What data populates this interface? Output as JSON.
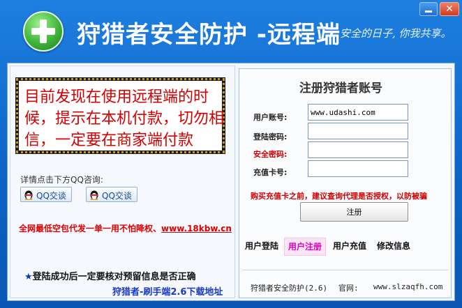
{
  "window": {
    "title": "狩猎者安全防护 -远程端",
    "slogan": "安全的日子, 你我共享。",
    "close_glyph": "✕"
  },
  "left": {
    "warning": "目前发现在使用远程端的时候，提示在本机付款，切勿相信，一定要在商家端付款",
    "detail": "详情点击下方QQ咨询:",
    "qq_buttons": [
      {
        "label": "QQ交谈",
        "icon": "penguin-icon"
      },
      {
        "label": "QQ交谈",
        "icon": "penguin-icon"
      }
    ],
    "promo_text": "全网最低空包代发一单一用不怕降权、",
    "promo_link": "www.18kbw.cn",
    "star": "★",
    "verify_note": "登陆成功后一定要核对预留信息是否正确",
    "download_link": "狩猎者-刷手端2.6下载地址"
  },
  "register": {
    "title": "注册狩猎者账号",
    "fields": [
      {
        "label": "用户账号:",
        "value": "www.udashi.com",
        "color": "#222222"
      },
      {
        "label": "登陆密码:",
        "value": "",
        "color": "#222222"
      },
      {
        "label": "安全密码:",
        "value": "",
        "color": "#d00000"
      },
      {
        "label": "充值卡号:",
        "value": "",
        "color": "#222222"
      }
    ],
    "notice": "购买充值卡之前，建议查询代理是否授权，以防被骗",
    "button": "注册",
    "tabs": [
      "用户登陆",
      "用户注册",
      "用户充值",
      "修改信息"
    ],
    "active_tab": "用户注册",
    "version": "狩猎者安全防护(2.6)",
    "site_label": "官网:",
    "site_url": "www.slzaqfh.com"
  },
  "colors": {
    "accent_blue": "#0b63c4",
    "warning_red": "#d40000",
    "active_tab": "#e000c0"
  }
}
